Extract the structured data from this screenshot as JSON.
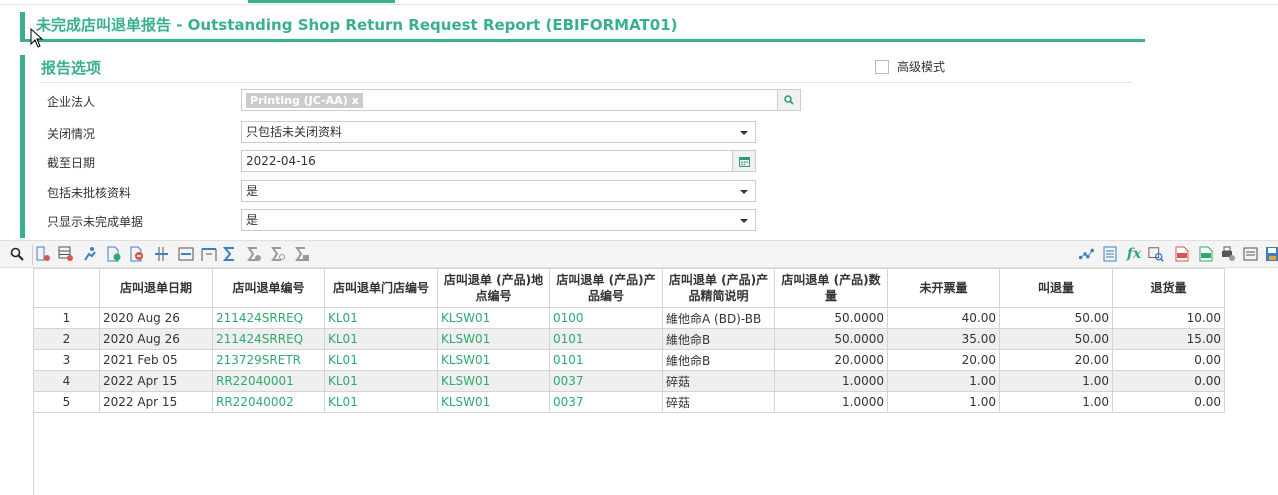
{
  "page": {
    "title": "未完成店叫退单报告 - Outstanding Shop Return Request Report (EBIFORMAT01)"
  },
  "options": {
    "section_title": "报告选项",
    "advanced_mode_label": "高级模式",
    "advanced_mode_checked": false,
    "fields": [
      {
        "label": "企业法人",
        "tag": "Printing (JC-AA)",
        "tag_remove": "x",
        "type": "multiselect-search"
      },
      {
        "label": "关闭情况",
        "value": "只包括未关闭资料",
        "type": "select"
      },
      {
        "label": "截至日期",
        "value": "2022-04-16",
        "type": "date"
      },
      {
        "label": "包括未批核资料",
        "value": "是",
        "type": "select"
      },
      {
        "label": "只显示未完成单据",
        "value": "是",
        "type": "select"
      }
    ]
  },
  "toolbar": {
    "left_icons": [
      "search-icon",
      "column-settings-icon",
      "grid-remove-icon",
      "run-report-icon",
      "export-add-icon",
      "remove-icon",
      "freeze-columns-icon",
      "fit-columns-icon",
      "expand-columns-icon",
      "sum-icon",
      "sum-remove-icon",
      "sum-search-icon",
      "sum-clear-icon"
    ],
    "right_icons": [
      "chart-icon",
      "layout-icon",
      "formula-icon",
      "find-icon",
      "pdf-icon",
      "xlsx-icon",
      "print-settings-icon",
      "print-preview-icon",
      "save-icon"
    ],
    "colors": {
      "green": "#2eaa6e",
      "blue": "#3d7fc7",
      "red": "#d9534f",
      "gray": "#9a9a9a"
    }
  },
  "table": {
    "columns": [
      "",
      "店叫退单日期",
      "店叫退单编号",
      "店叫退单门店编号",
      "店叫退单 (产品)地点编号",
      "店叫退单 (产品)产品编号",
      "店叫退单 (产品)产品精简说明",
      "店叫退单 (产品)数量",
      "未开票量",
      "叫退量",
      "退货量"
    ],
    "rows": [
      [
        "1",
        "2020 Aug 26",
        "211424SRREQ",
        "KL01",
        "KLSW01",
        "0100",
        "維他命A (BD)-BB",
        "50.0000",
        "40.00",
        "50.00",
        "10.00"
      ],
      [
        "2",
        "2020 Aug 26",
        "211424SRREQ",
        "KL01",
        "KLSW01",
        "0101",
        "維他命B",
        "50.0000",
        "35.00",
        "50.00",
        "15.00"
      ],
      [
        "3",
        "2021 Feb 05",
        "213729SRETR",
        "KL01",
        "KLSW01",
        "0101",
        "維他命B",
        "20.0000",
        "20.00",
        "20.00",
        "0.00"
      ],
      [
        "4",
        "2022 Apr 15",
        "RR22040001",
        "KL01",
        "KLSW01",
        "0037",
        "碎菇",
        "1.0000",
        "1.00",
        "1.00",
        "0.00"
      ],
      [
        "5",
        "2022 Apr 15",
        "RR22040002",
        "KL01",
        "KLSW01",
        "0037",
        "碎菇",
        "1.0000",
        "1.00",
        "1.00",
        "0.00"
      ]
    ]
  },
  "theme": {
    "accent": "#3aaf8f",
    "link": "#2eaa6e"
  }
}
